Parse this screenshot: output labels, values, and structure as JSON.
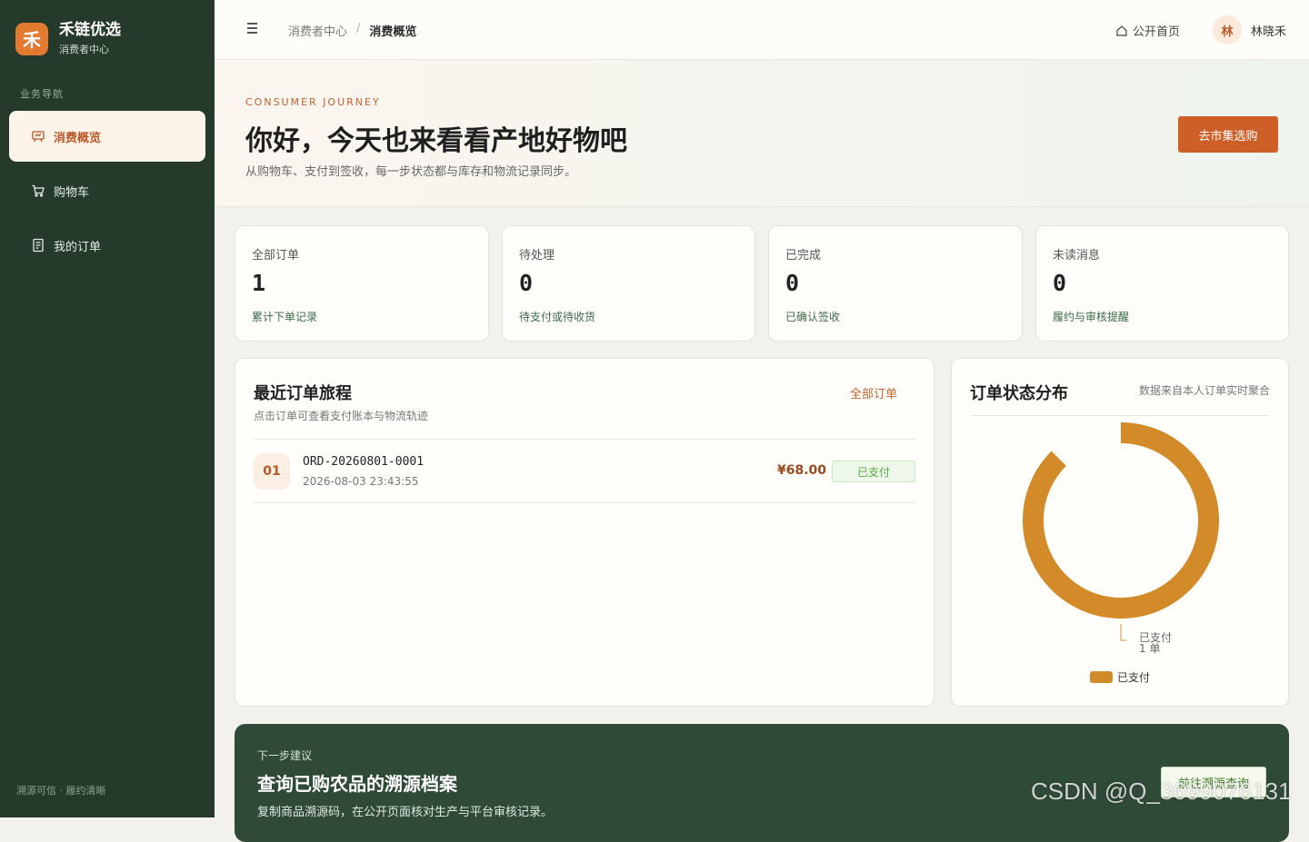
{
  "brand": {
    "logo_char": "禾",
    "name": "禾链优选",
    "subtitle": "消费者中心"
  },
  "sidebar": {
    "section_title": "业务导航",
    "items": [
      {
        "label": "消费概览",
        "icon": "chart-board-icon",
        "active": true
      },
      {
        "label": "购物车",
        "icon": "cart-icon",
        "active": false
      },
      {
        "label": "我的订单",
        "icon": "document-icon",
        "active": false
      }
    ],
    "footer": "溯源可信 · 履约清晰"
  },
  "topbar": {
    "breadcrumb": [
      "消费者中心",
      "消费概览"
    ],
    "breadcrumb_sep": "/",
    "home_link": "公开首页",
    "avatar_char": "林",
    "username": "林晓禾"
  },
  "hero": {
    "kicker": "CONSUMER JOURNEY",
    "title": "你好，今天也来看看产地好物吧",
    "desc": "从购物车、支付到签收，每一步状态都与库存和物流记录同步。",
    "cta": "去市集选购"
  },
  "stats": [
    {
      "label": "全部订单",
      "value": "1",
      "note": "累计下单记录"
    },
    {
      "label": "待处理",
      "value": "0",
      "note": "待支付或待收货"
    },
    {
      "label": "已完成",
      "value": "0",
      "note": "已确认签收"
    },
    {
      "label": "未读消息",
      "value": "0",
      "note": "履约与审核提醒"
    }
  ],
  "recent_orders": {
    "title": "最近订单旅程",
    "subtitle": "点击订单可查看支付账本与物流轨迹",
    "link": "全部订单",
    "rows": [
      {
        "index": "01",
        "order_no": "ORD-20260801-0001",
        "time": "2026-08-03 23:43:55",
        "amount": "¥68.00",
        "status": "已支付"
      }
    ]
  },
  "status_distribution": {
    "title": "订单状态分布",
    "note": "数据来自本人订单实时聚合",
    "chart_data": {
      "type": "pie",
      "categories": [
        "已支付"
      ],
      "values": [
        1
      ],
      "slice_labels": [
        "已支付",
        "1 单"
      ],
      "colors": [
        "#d38b29"
      ],
      "legend": "bottom"
    }
  },
  "next_step": {
    "kicker": "下一步建议",
    "title": "查询已购农品的溯源档案",
    "desc": "复制商品溯源码，在公开页面核对生产与平台审核记录。",
    "button": "前往溯源查询"
  },
  "watermark": "CSDN @Q_3699076131"
}
